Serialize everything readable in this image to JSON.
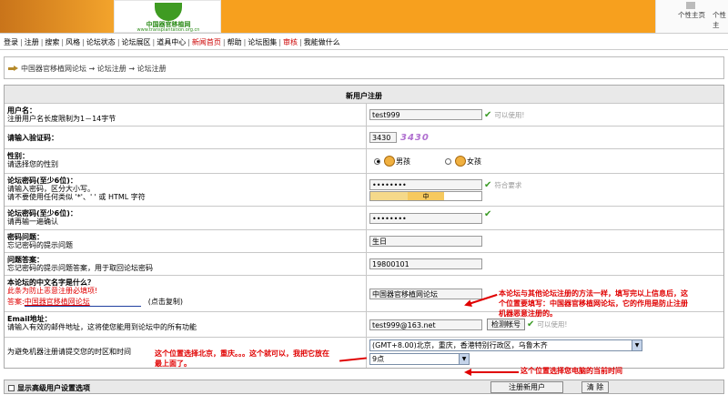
{
  "banner": {
    "logo_title": "中国器官移植网",
    "logo_url": "www.transplantation.org.cn",
    "right_items": [
      "个性主页",
      "个性主"
    ]
  },
  "nav": {
    "items": [
      "登录",
      "注册",
      "搜索",
      "风格",
      "论坛状态",
      "论坛展区",
      "道具中心",
      "新闻首页",
      "帮助",
      "论坛图集",
      "审核",
      "我能做什么"
    ]
  },
  "breadcrumb": {
    "items": [
      "中国器官移植网论坛",
      "论坛注册",
      "论坛注册"
    ]
  },
  "form": {
    "header": "新用户注册",
    "username": {
      "label": "用户名：",
      "hint": "注册用户名长度限制为1－14字节",
      "value": "test999",
      "ok": "可以使用!"
    },
    "captcha": {
      "label": "请输入验证码：",
      "value": "3430",
      "image_text": "3430"
    },
    "gender": {
      "label": "性别：",
      "hint": "请选择您的性别",
      "male": "男孩",
      "female": "女孩"
    },
    "password": {
      "label": "论坛密码(至少6位)：",
      "hint1": "请输入密码，区分大小写。",
      "hint2": "请不要使用任何类似 '*'、' ' 或 HTML 字符",
      "value": "••••••••",
      "ok": "符合要求",
      "strength": "中"
    },
    "password2": {
      "label": "论坛密码(至少6位)：",
      "hint": "请再输一遍确认",
      "value": "••••••••"
    },
    "question": {
      "label": "密码问题：",
      "hint": "忘记密码的提示问题",
      "value": "生日"
    },
    "answer": {
      "label": "问题答案：",
      "hint": "忘记密码的提示问题答案，用于取回论坛密码",
      "value": "19800101"
    },
    "chinese_name": {
      "label": "本论坛的中文名字是什么？",
      "red_note": "此条为防止恶意注册必填项!",
      "answer_label": "答案:",
      "answer_link": "中国器官移植网论坛",
      "copy_note": "(点击复制)",
      "value": "中国器官移植网论坛"
    },
    "email": {
      "label": "Email地址：",
      "hint": "请输入有效的邮件地址，这将使您能用到论坛中的所有功能",
      "value": "test999@163.net",
      "check_btn": "检测帐号",
      "ok": "可以使用!"
    },
    "timezone": {
      "hint": "为避免机器注册请提交您的时区和时间",
      "zone": "(GMT+8.00)北京，重庆，香港特别行政区，乌鲁木齐",
      "hour": "9点"
    }
  },
  "annotations": {
    "a1_line1": "本论坛与其他论坛注册的方法一样，填写完以上信息后，这",
    "a1_line2": "个位置要填写：中国器官移植网论坛，它的作用是防止注册",
    "a1_line3": "机器恶意注册的。",
    "a2_line1": "这个位置选择北京，重庆。。。这个就可以，我把它放在",
    "a2_line2": "最上面了。",
    "a3": "这个位置选择您电脑的当前时间"
  },
  "footer": {
    "advanced": "显示高级用户设置选项",
    "submit": "注册新用户",
    "clear": "清 除"
  },
  "colors": {
    "banner": "#f7a01e",
    "ok_green": "#3a9b25",
    "annotation_red": "#e00000"
  }
}
